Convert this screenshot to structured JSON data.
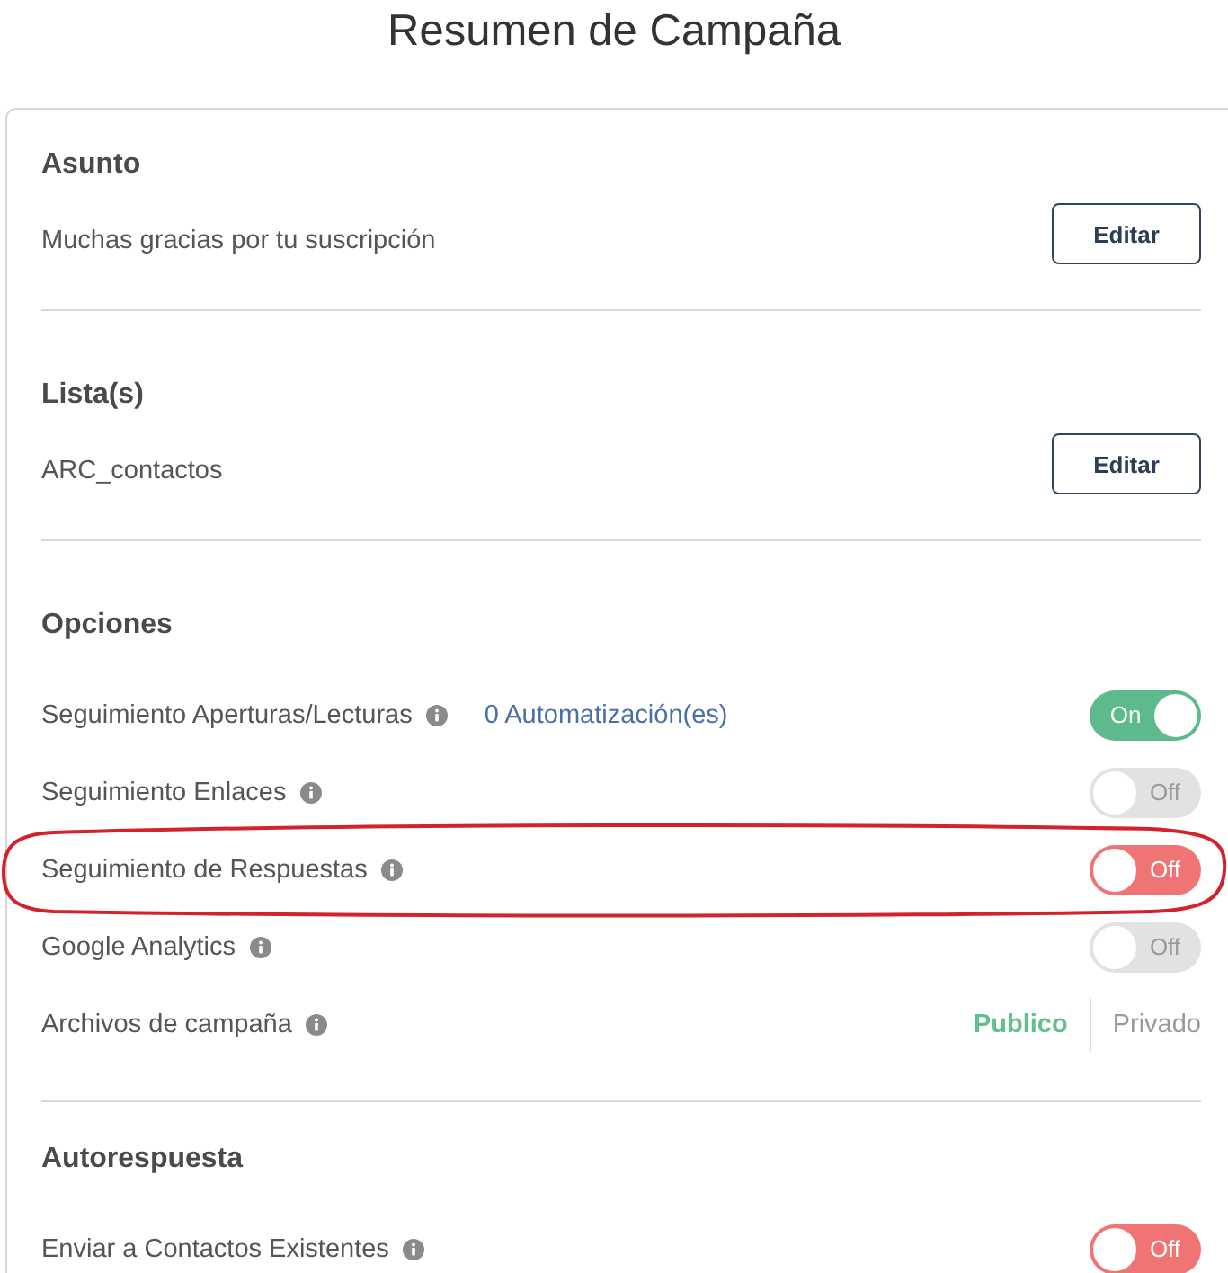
{
  "title": "Resumen de Campaña",
  "sections": [
    {
      "kind": "edit",
      "heading": "Asunto",
      "value": "Muchas gracias por tu suscripción",
      "button": "Editar"
    },
    {
      "kind": "edit",
      "heading": "Lista(s)",
      "value": "ARC_contactos",
      "button": "Editar"
    },
    {
      "kind": "options",
      "heading": "Opciones",
      "options": [
        {
          "kind": "toggle",
          "label": "Seguimiento Aperturas/Lecturas",
          "link": "0 Automatización(es)",
          "on": true,
          "disabled": false,
          "toggle_label": "On",
          "highlighted": false
        },
        {
          "kind": "toggle",
          "label": "Seguimiento Enlaces",
          "on": false,
          "disabled": true,
          "toggle_label": "Off",
          "highlighted": false
        },
        {
          "kind": "toggle",
          "label": "Seguimiento de Respuestas",
          "on": false,
          "disabled": false,
          "toggle_label": "Off",
          "highlighted": true
        },
        {
          "kind": "toggle",
          "label": "Google Analytics",
          "on": false,
          "disabled": true,
          "toggle_label": "Off",
          "highlighted": false
        },
        {
          "kind": "choice",
          "label": "Archivos de campaña",
          "choices": [
            {
              "label": "Publico",
              "selected": true
            },
            {
              "label": "Privado",
              "selected": false
            }
          ],
          "highlighted": false
        }
      ]
    },
    {
      "kind": "options",
      "heading": "Autorespuesta",
      "options": [
        {
          "kind": "toggle",
          "label": "Enviar a Contactos Existentes",
          "on": false,
          "disabled": false,
          "toggle_label": "Off",
          "highlighted": false
        }
      ]
    }
  ]
}
